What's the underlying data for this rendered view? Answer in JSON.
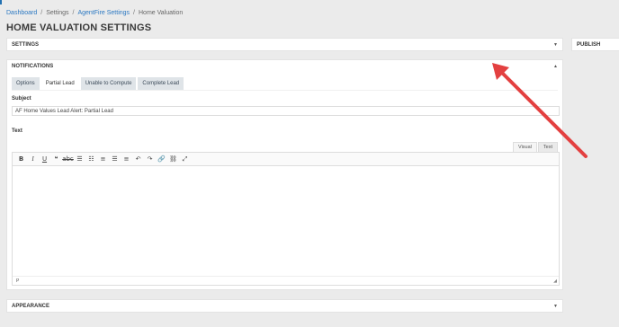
{
  "breadcrumb": {
    "items": [
      "Dashboard",
      "Settings",
      "AgentFire Settings",
      "Home Valuation"
    ],
    "separator": "/"
  },
  "page": {
    "title": "HOME VALUATION SETTINGS"
  },
  "panels": {
    "settings": {
      "label": "SETTINGS",
      "caret": "▼"
    },
    "publish": {
      "label": "PUBLISH"
    },
    "notifications": {
      "label": "NOTIFICATIONS",
      "caret": "▲"
    },
    "appearance": {
      "label": "APPEARANCE",
      "caret": "▼"
    }
  },
  "tabs": [
    {
      "label": "Options",
      "active": false
    },
    {
      "label": "Partial Lead",
      "active": true
    },
    {
      "label": "Unable to Compute",
      "active": false
    },
    {
      "label": "Complete Lead",
      "active": false
    }
  ],
  "form": {
    "subject_label": "Subject",
    "subject_value": "AF Home Values Lead Alert: Partial Lead",
    "text_label": "Text"
  },
  "editor": {
    "visual_label": "Visual",
    "text_label": "Text",
    "status_path": "P",
    "toolbar": [
      {
        "name": "bold-icon",
        "glyph": "B",
        "cls": "b"
      },
      {
        "name": "italic-icon",
        "glyph": "I",
        "cls": "i"
      },
      {
        "name": "underline-icon",
        "glyph": "U",
        "cls": "u"
      },
      {
        "name": "blockquote-icon",
        "glyph": "❝",
        "cls": ""
      },
      {
        "name": "strikethrough-icon",
        "glyph": "abc",
        "cls": "s"
      },
      {
        "name": "bullet-list-icon",
        "glyph": "☰",
        "cls": ""
      },
      {
        "name": "numbered-list-icon",
        "glyph": "☷",
        "cls": ""
      },
      {
        "name": "align-left-icon",
        "glyph": "≡",
        "cls": ""
      },
      {
        "name": "align-center-icon",
        "glyph": "☰",
        "cls": ""
      },
      {
        "name": "align-right-icon",
        "glyph": "≡",
        "cls": ""
      },
      {
        "name": "undo-icon",
        "glyph": "↶",
        "cls": ""
      },
      {
        "name": "redo-icon",
        "glyph": "↷",
        "cls": ""
      },
      {
        "name": "link-icon",
        "glyph": "🔗",
        "cls": ""
      },
      {
        "name": "unlink-icon",
        "glyph": "⛓",
        "cls": ""
      },
      {
        "name": "fullscreen-icon",
        "glyph": "⤢",
        "cls": ""
      }
    ]
  },
  "colors": {
    "link": "#2b78c2",
    "arrow": "#e34040",
    "tab_inactive_bg": "#dfe4e8"
  }
}
